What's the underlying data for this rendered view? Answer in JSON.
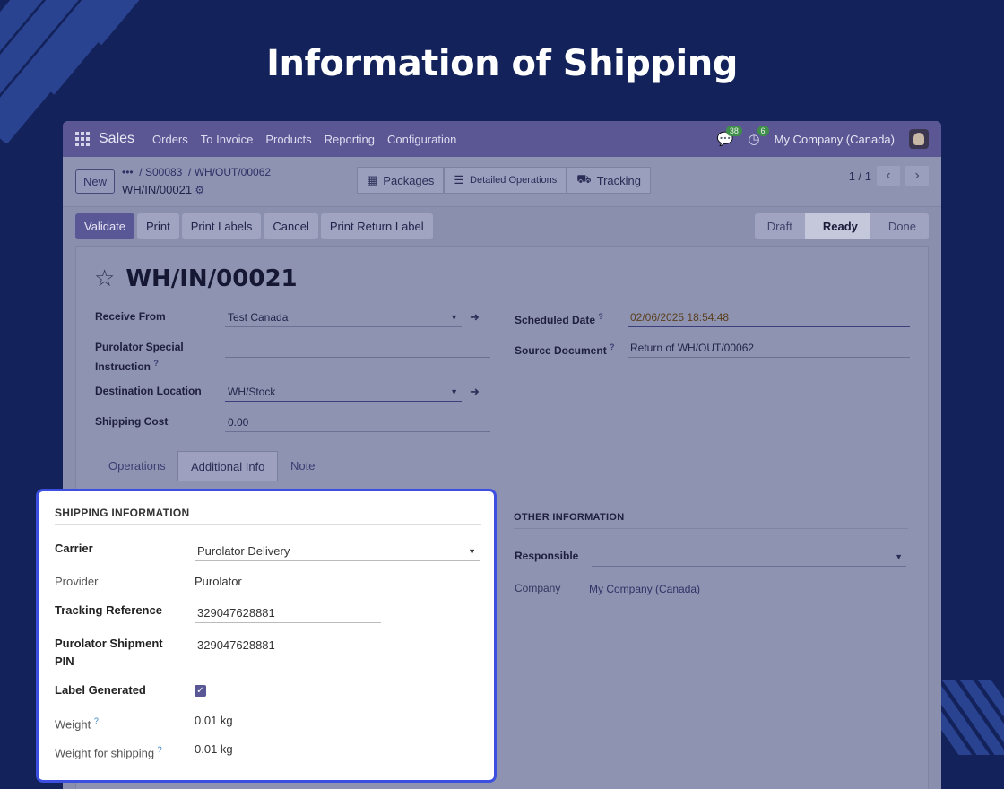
{
  "banner": {
    "title": "Information of Shipping"
  },
  "topnav": {
    "app_name": "Sales",
    "menu": [
      "Orders",
      "To Invoice",
      "Products",
      "Reporting",
      "Configuration"
    ],
    "messages_count": "38",
    "activities_count": "6",
    "company": "My Company (Canada)"
  },
  "control": {
    "new_label": "New",
    "breadcrumb": [
      "•••",
      "S00083",
      "WH/OUT/00062"
    ],
    "current": "WH/IN/00021",
    "view_buttons": [
      "Packages",
      "Detailed Operations",
      "Tracking"
    ],
    "pager": "1 / 1"
  },
  "actions": [
    "Validate",
    "Print",
    "Print Labels",
    "Cancel",
    "Print Return Label"
  ],
  "status": [
    "Draft",
    "Ready",
    "Done"
  ],
  "record": {
    "title": "WH/IN/00021",
    "receive_from_label": "Receive From",
    "receive_from": "Test Canada",
    "purolator_instr_label_1": "Purolator Special",
    "purolator_instr_label_2": "Instruction",
    "destination_label": "Destination Location",
    "destination": "WH/Stock",
    "shipping_cost_label": "Shipping Cost",
    "shipping_cost": "0.00",
    "scheduled_label": "Scheduled Date",
    "scheduled": "02/06/2025 18:54:48",
    "source_label": "Source Document",
    "source": "Return of WH/OUT/00062",
    "help_mark": "?"
  },
  "tabs": [
    "Operations",
    "Additional Info",
    "Note"
  ],
  "other_info": {
    "heading": "OTHER INFORMATION",
    "responsible_label": "Responsible",
    "company_label": "Company",
    "company": "My Company (Canada)"
  },
  "shipping": {
    "heading": "SHIPPING INFORMATION",
    "carrier_label": "Carrier",
    "carrier": "Purolator Delivery",
    "provider_label": "Provider",
    "provider": "Purolator",
    "tracking_label": "Tracking Reference",
    "tracking": "329047628881",
    "pin_label_1": "Purolator Shipment",
    "pin_label_2": "PIN",
    "pin": "329047628881",
    "label_generated_label": "Label Generated",
    "label_generated": true,
    "weight_label": "Weight",
    "weight": "0.01 kg",
    "weight_ship_label": "Weight for shipping",
    "weight_ship": "0.01 kg"
  }
}
